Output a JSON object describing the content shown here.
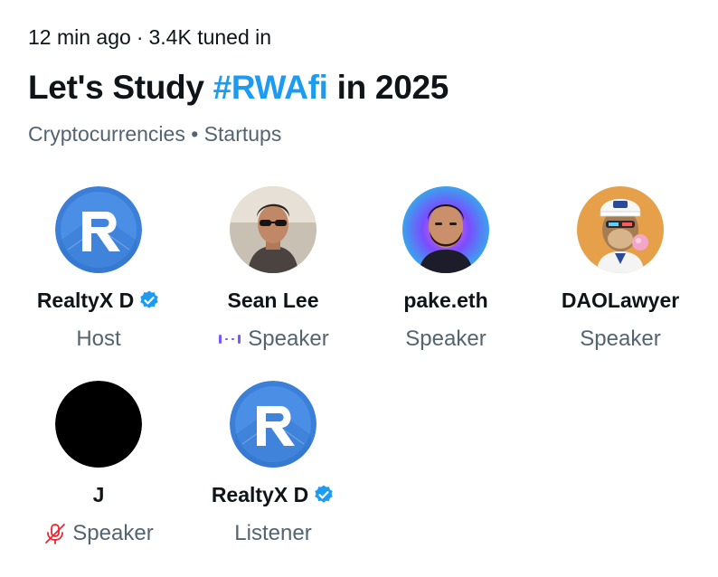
{
  "space": {
    "time_ago": "12 min ago",
    "separator": "·",
    "tuned_in": "3.4K tuned in",
    "title_prefix": "Let's Study ",
    "title_hashtag": "#RWAfi",
    "title_suffix": " in 2025",
    "topics": "Cryptocurrencies • Startups",
    "hashtag_color": "#1d9bf0"
  },
  "participants": [
    {
      "name": "RealtyX D",
      "role": "Host",
      "verified": true,
      "avatar": "realtyx-logo"
    },
    {
      "name": "Sean Lee",
      "role": "Speaker",
      "verified": false,
      "avatar": "photo-man-sunglasses",
      "status_icon": "speaking-waveform-icon"
    },
    {
      "name": "pake.eth",
      "role": "Speaker",
      "verified": false,
      "avatar": "photo-bearded-man"
    },
    {
      "name": "DAOLawyer",
      "role": "Speaker",
      "verified": false,
      "avatar": "ape-nft"
    },
    {
      "name": "J",
      "role": "Speaker",
      "verified": false,
      "avatar": "black-circle",
      "status_icon": "muted-mic-icon"
    },
    {
      "name": "RealtyX D",
      "role": "Listener",
      "verified": true,
      "avatar": "realtyx-logo"
    }
  ]
}
